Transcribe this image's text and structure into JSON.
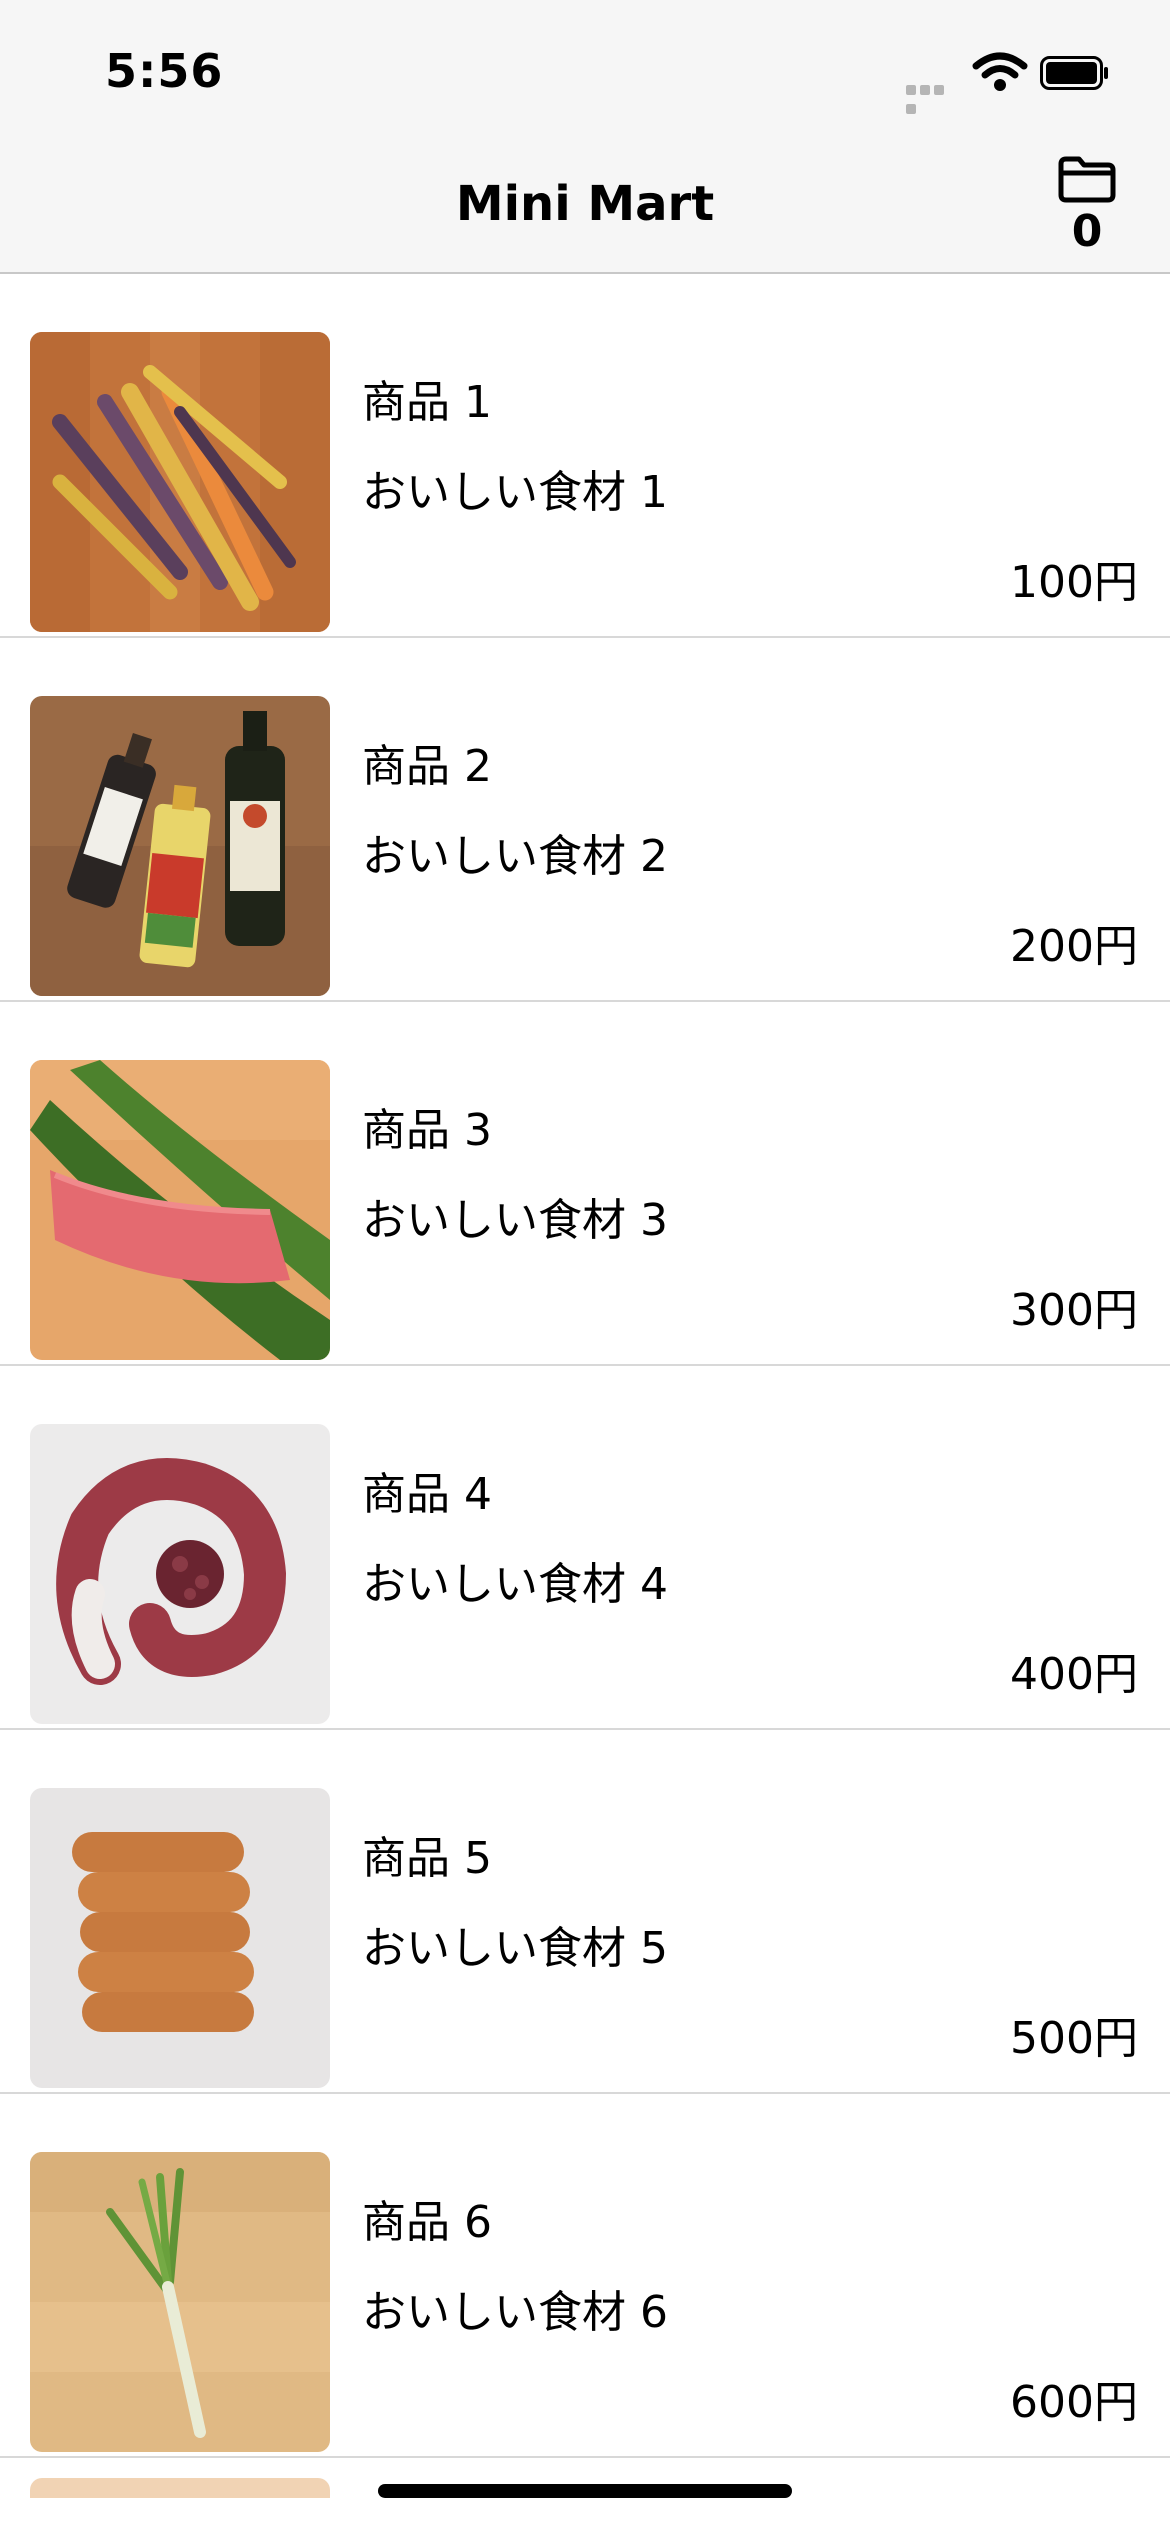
{
  "status_bar": {
    "time": "5:56",
    "icons": [
      "cellular-signal-icon",
      "wifi-icon",
      "battery-icon"
    ]
  },
  "nav": {
    "title": "Mini Mart",
    "cart_icon": "folder-icon",
    "cart_count": "0"
  },
  "items": [
    {
      "name": "商品 1",
      "description": "おいしい食材 1",
      "price": "100円",
      "image": "carrots"
    },
    {
      "name": "商品 2",
      "description": "おいしい食材 2",
      "price": "200円",
      "image": "oil bottles"
    },
    {
      "name": "商品 3",
      "description": "おいしい食材 3",
      "price": "300円",
      "image": "tuna on bamboo leaves"
    },
    {
      "name": "商品 4",
      "description": "おいしい食材 4",
      "price": "400円",
      "image": "octopus tentacle"
    },
    {
      "name": "商品 5",
      "description": "おいしい食材 5",
      "price": "500円",
      "image": "sausages"
    },
    {
      "name": "商品 6",
      "description": "おいしい食材 6",
      "price": "600円",
      "image": "green onion"
    }
  ],
  "colors": {
    "bar_background": "#f6f6f6",
    "separator": "#d8d8d8",
    "text": "#000000"
  }
}
